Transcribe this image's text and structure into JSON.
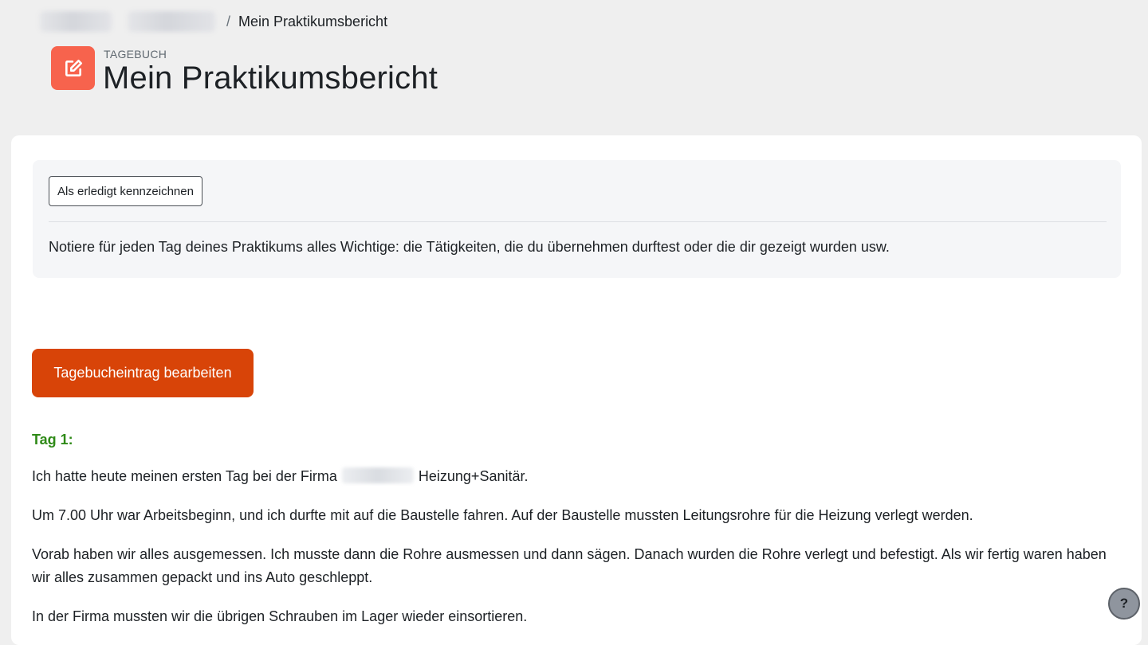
{
  "breadcrumb": {
    "separator": "/",
    "current": "Mein Praktikumsbericht"
  },
  "header": {
    "activity_icon": "edit-icon",
    "activity_type": "TAGEBUCH",
    "title": "Mein Praktikumsbericht",
    "icon_color": "#f7634d"
  },
  "activity_info": {
    "done_button_label": "Als erledigt kennzeichnen",
    "description": "Notiere für jeden Tag deines Praktikums alles Wichtige: die Tätigkeiten, die du übernehmen durftest oder die dir gezeigt wurden usw."
  },
  "edit_button": {
    "label": "Tagebucheintrag bearbeiten",
    "color": "#d84408"
  },
  "entry": {
    "day_heading": "Tag 1:",
    "heading_color": "#2f8a18",
    "p1_before": "Ich hatte heute meinen ersten Tag bei der Firma",
    "p1_after": "Heizung+Sanitär.",
    "p2": "Um 7.00 Uhr war Arbeitsbeginn, und ich durfte mit auf die Baustelle fahren. Auf der Baustelle mussten Leitungsrohre für die Heizung verlegt werden.",
    "p3": "Vorab haben wir alles ausgemessen. Ich musste dann die Rohre ausmessen und dann sägen. Danach wurden die Rohre verlegt und befestigt. Als wir fertig waren haben wir alles zusammen gepackt und ins Auto geschleppt.",
    "p4": "In der Firma mussten wir die übrigen Schrauben im Lager wieder einsortieren."
  },
  "help": {
    "label": "?"
  }
}
